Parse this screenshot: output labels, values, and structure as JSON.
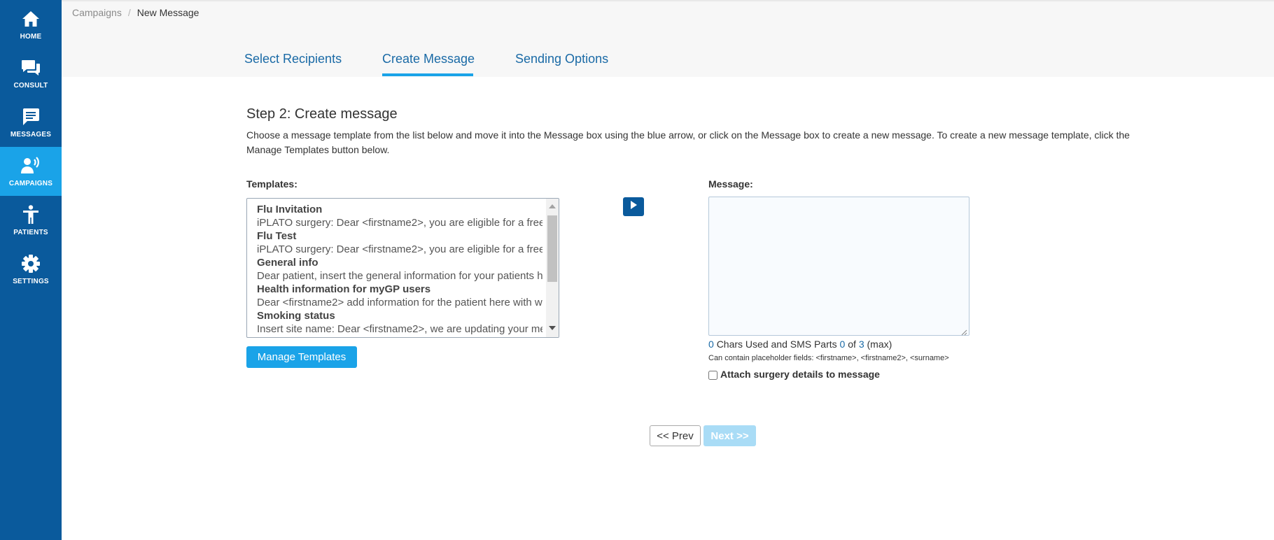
{
  "sidebar": {
    "items": [
      {
        "label": "HOME",
        "icon": "home-icon",
        "active": false
      },
      {
        "label": "CONSULT",
        "icon": "chat-bubbles-icon",
        "active": false
      },
      {
        "label": "MESSAGES",
        "icon": "message-icon",
        "active": false
      },
      {
        "label": "CAMPAIGNS",
        "icon": "broadcast-person-icon",
        "active": true
      },
      {
        "label": "PATIENTS",
        "icon": "person-icon",
        "active": false
      },
      {
        "label": "SETTINGS",
        "icon": "gear-icon",
        "active": false
      }
    ]
  },
  "breadcrumb": {
    "parent": "Campaigns",
    "separator": "/",
    "current": "New Message"
  },
  "tabs": [
    {
      "label": "Select Recipients",
      "active": false
    },
    {
      "label": "Create Message",
      "active": true
    },
    {
      "label": "Sending Options",
      "active": false
    }
  ],
  "step": {
    "title": "Step 2: Create message",
    "intro": "Choose a message template from the list below and move it into the Message box using the blue arrow, or click on the Message box to create a new message. To create a new message template, click the Manage Templates button below."
  },
  "templates": {
    "label": "Templates:",
    "items": [
      {
        "name": "Flu Invitation",
        "body": "iPLATO surgery: Dear <firstname2>, you are eligible for a free"
      },
      {
        "name": "Flu Test",
        "body": "iPLATO surgery: Dear <firstname2>, you are eligible for a free"
      },
      {
        "name": "General info",
        "body": "Dear patient, insert the general information for your patients h"
      },
      {
        "name": "Health information for myGP users",
        "body": "Dear <firstname2> add information for the patient here with w"
      },
      {
        "name": "Smoking status",
        "body": "Insert site name: Dear <firstname2>, we are updating your me"
      }
    ],
    "manage_button": "Manage Templates"
  },
  "message": {
    "label": "Message:",
    "value": "",
    "chars_used": "0",
    "chars_text": "Chars Used and SMS Parts",
    "sms_parts": "0",
    "of_text": "of",
    "max_parts": "3",
    "max_text": "(max)",
    "placeholder_note": "Can contain placeholder fields: <firstname>, <firstname2>, <surname>",
    "attach_label": "Attach surgery details to message",
    "attach_checked": false
  },
  "navigation": {
    "prev_label": "<< Prev",
    "next_label": "Next >>"
  },
  "colors": {
    "sidebar": "#0a5a9c",
    "active": "#1aa3e8",
    "link": "#1a6aa6",
    "next_disabled": "#a9dcf6"
  }
}
